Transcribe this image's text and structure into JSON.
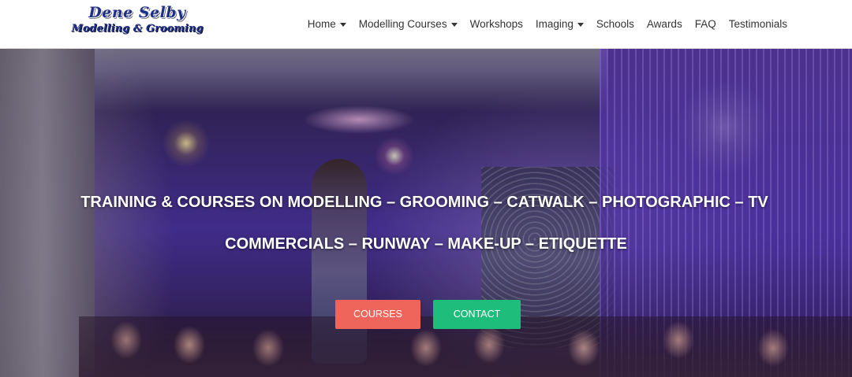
{
  "logo": {
    "line1": "Dene Selby",
    "line2": "Modelling & Grooming"
  },
  "nav": {
    "items": [
      {
        "label": "Home",
        "has_dropdown": true
      },
      {
        "label": "Modelling Courses",
        "has_dropdown": true
      },
      {
        "label": "Workshops",
        "has_dropdown": false
      },
      {
        "label": "Imaging",
        "has_dropdown": true
      },
      {
        "label": "Schools",
        "has_dropdown": false
      },
      {
        "label": "Awards",
        "has_dropdown": false
      },
      {
        "label": "FAQ",
        "has_dropdown": false
      },
      {
        "label": "Testimonials",
        "has_dropdown": false
      }
    ]
  },
  "hero": {
    "line1": "TRAINING & COURSES ON MODELLING – GROOMING – CATWALK – PHOTOGRAPHIC – TV",
    "line2": "COMMERCIALS – RUNWAY – MAKE-UP – ETIQUETTE",
    "buttons": {
      "courses_label": "COURSES",
      "contact_label": "CONTACT"
    }
  },
  "colors": {
    "logo_text": "#1d2f86",
    "nav_text": "#333333",
    "courses_button": "#f0655b",
    "contact_button": "#1ebd7c",
    "hero_text": "#ffffff"
  }
}
